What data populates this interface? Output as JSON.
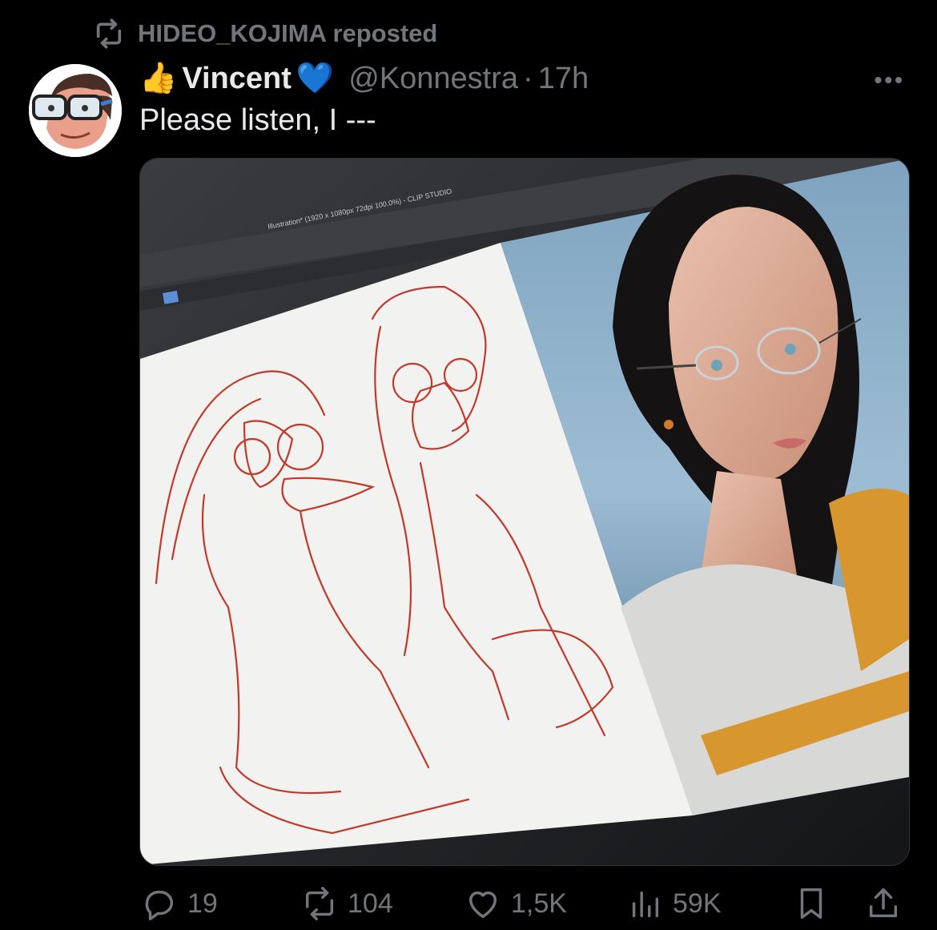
{
  "repost": {
    "label": "HIDEO_KOJIMA reposted"
  },
  "author": {
    "emoji": "👍",
    "name": "Vincent",
    "badge": "💙",
    "handle": "@Konnestra",
    "separator": "·",
    "time": "17h"
  },
  "more_label": "•••",
  "tweet": {
    "text": "Please listen, I ---"
  },
  "media": {
    "screen_title": "Illustration* (1920 x 1080px 72dpi 100.0%) - CLIP STUDIO",
    "description_colors": {
      "sketch": "#c0392b",
      "paper": "#f2f2f0",
      "bezel": "#2a2c2f"
    }
  },
  "actions": {
    "replies": "19",
    "reposts": "104",
    "likes": "1,5K",
    "views": "59K"
  },
  "colors": {
    "muted": "#71767b",
    "text": "#e7e9ea",
    "background": "#000000",
    "heart": "#3b8ef0"
  }
}
